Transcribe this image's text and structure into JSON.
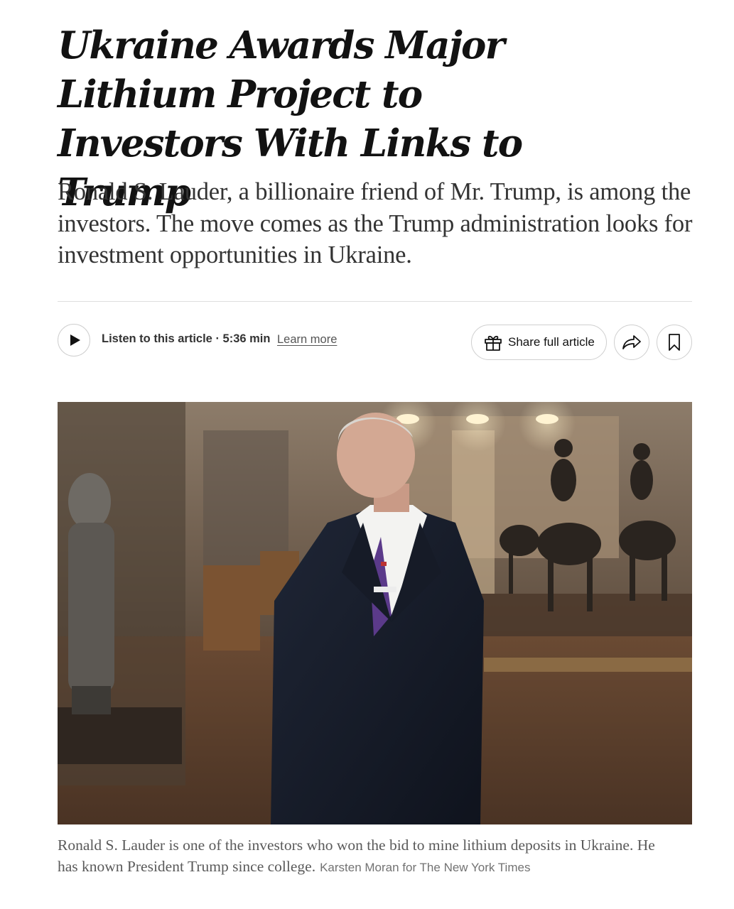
{
  "article": {
    "headline": "Ukraine Awards Major Lithium Project to Investors With Links to Trump",
    "summary": "Ronald S. Lauder, a billionaire friend of Mr. Trump, is among the investors. The move comes as the Trump administration looks for investment opportunities in Ukraine."
  },
  "toolbar": {
    "listen_label": "Listen to this article · 5:36 min",
    "learn_more": "Learn more",
    "share_full_label": "Share full article",
    "icons": {
      "play": "play-icon",
      "gift": "gift-icon",
      "share": "share-arrow-icon",
      "bookmark": "bookmark-icon"
    }
  },
  "photo": {
    "caption": "Ronald S. Lauder is one of the investors who won the bid to mine lithium deposits in Ukraine. He has known President Trump since college.",
    "credit": "Karsten Moran for The New York Times"
  },
  "colors": {
    "text": "#121212",
    "summary_text": "#333333",
    "caption_text": "#5a5a5a",
    "border": "#cfcfcf"
  }
}
